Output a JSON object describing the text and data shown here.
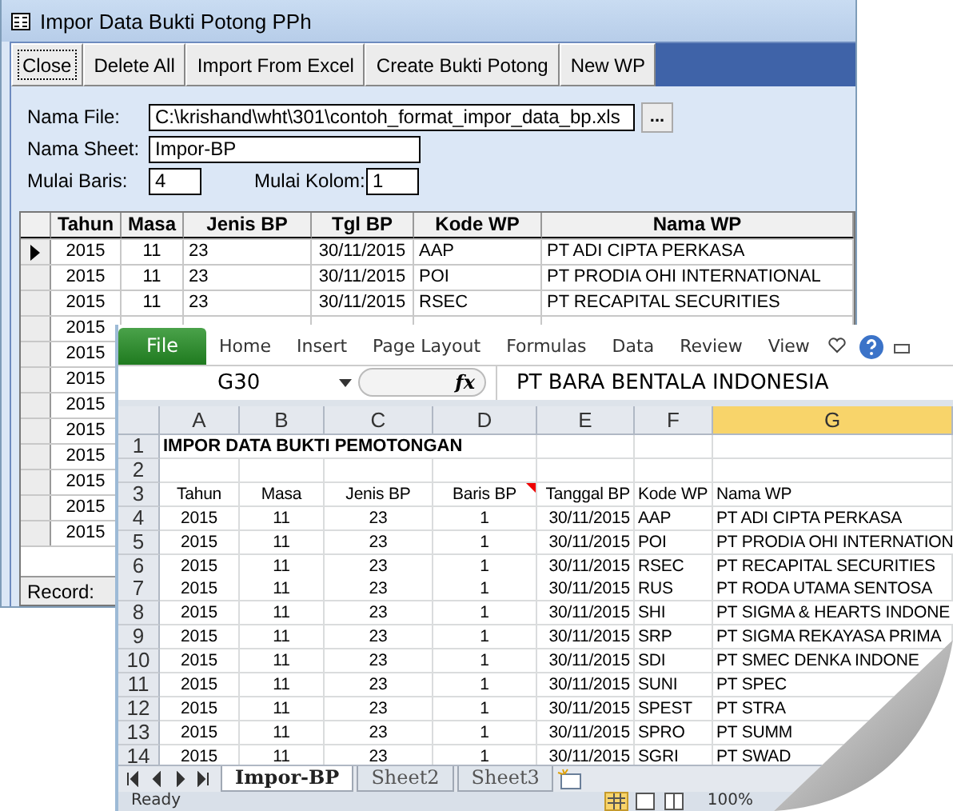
{
  "access_window": {
    "title": "Impor Data Bukti Potong PPh",
    "toolbar": [
      {
        "label": "Close",
        "focused": true
      },
      {
        "label": "Delete All",
        "focused": false
      },
      {
        "label": "Import From Excel",
        "focused": false
      },
      {
        "label": "Create Bukti Potong",
        "focused": false
      },
      {
        "label": "New WP",
        "focused": false
      }
    ],
    "file": {
      "label": "Nama File:",
      "value": "C:\\krishand\\wht\\301\\contoh_format_impor_data_bp.xls",
      "browse": "..."
    },
    "sheet": {
      "label": "Nama Sheet:",
      "value": "Impor-BP"
    },
    "start_row": {
      "label": "Mulai Baris:",
      "value": "4"
    },
    "start_col": {
      "label": "Mulai Kolom:",
      "value": "1"
    },
    "grid": {
      "columns": [
        "Tahun",
        "Masa",
        "Jenis BP",
        "Tgl BP",
        "Kode WP",
        "Nama WP"
      ],
      "rows": [
        {
          "selected": true,
          "cells": [
            "2015",
            "11",
            "23",
            "30/11/2015",
            "AAP",
            "PT ADI CIPTA PERKASA"
          ]
        },
        {
          "selected": false,
          "cells": [
            "2015",
            "11",
            "23",
            "30/11/2015",
            "POI",
            "PT PRODIA OHI INTERNATIONAL"
          ]
        },
        {
          "selected": false,
          "cells": [
            "2015",
            "11",
            "23",
            "30/11/2015",
            "RSEC",
            "PT RECAPITAL SECURITIES"
          ]
        },
        {
          "selected": false,
          "cells": [
            "2015"
          ]
        },
        {
          "selected": false,
          "cells": [
            "2015"
          ]
        },
        {
          "selected": false,
          "cells": [
            "2015"
          ]
        },
        {
          "selected": false,
          "cells": [
            "2015"
          ]
        },
        {
          "selected": false,
          "cells": [
            "2015"
          ]
        },
        {
          "selected": false,
          "cells": [
            "2015"
          ]
        },
        {
          "selected": false,
          "cells": [
            "2015"
          ]
        },
        {
          "selected": false,
          "cells": [
            "2015"
          ]
        },
        {
          "selected": false,
          "cells": [
            "2015"
          ]
        }
      ],
      "record_label": "Record:"
    }
  },
  "excel_window": {
    "ribbon_tabs": [
      {
        "label": "File",
        "kind": "file"
      },
      {
        "label": "Home",
        "kind": "tab"
      },
      {
        "label": "Insert",
        "kind": "tab"
      },
      {
        "label": "Page Layout",
        "kind": "tab"
      },
      {
        "label": "Formulas",
        "kind": "tab"
      },
      {
        "label": "Data",
        "kind": "tab"
      },
      {
        "label": "Review",
        "kind": "tab"
      },
      {
        "label": "View",
        "kind": "tab"
      }
    ],
    "name_box": "G30",
    "fx": "fx",
    "formula": "PT BARA BENTALA INDONESIA",
    "columns": [
      {
        "label": "A",
        "selected": false
      },
      {
        "label": "B",
        "selected": false
      },
      {
        "label": "C",
        "selected": false
      },
      {
        "label": "D",
        "selected": false
      },
      {
        "label": "E",
        "selected": false
      },
      {
        "label": "F",
        "selected": false
      },
      {
        "label": "G",
        "selected": true
      }
    ],
    "rows": [
      {
        "number": "1",
        "kind": "title",
        "cells": [
          "IMPOR DATA BUKTI PEMOTONGAN"
        ]
      },
      {
        "number": "2",
        "kind": "blank",
        "cells": []
      },
      {
        "number": "3",
        "kind": "header",
        "cells": [
          "Tahun",
          "Masa",
          "Jenis BP",
          "Baris BP",
          "Tanggal BP",
          "Kode WP",
          "Nama WP"
        ],
        "comment_flags": [
          false,
          false,
          false,
          true,
          false,
          false,
          false
        ]
      },
      {
        "number": "4",
        "kind": "data",
        "cells": [
          "2015",
          "11",
          "23",
          "1",
          "30/11/2015",
          "AAP",
          "PT ADI CIPTA PERKASA"
        ]
      },
      {
        "number": "5",
        "kind": "data",
        "cells": [
          "2015",
          "11",
          "23",
          "1",
          "30/11/2015",
          "POI",
          "PT PRODIA OHI INTERNATION"
        ]
      },
      {
        "number": "6",
        "kind": "data",
        "cells": [
          "2015",
          "11",
          "23",
          "1",
          "30/11/2015",
          "RSEC",
          "PT RECAPITAL SECURITIES"
        ]
      },
      {
        "number": "7",
        "kind": "data",
        "cells": [
          "2015",
          "11",
          "23",
          "1",
          "30/11/2015",
          "RUS",
          "PT RODA UTAMA SENTOSA"
        ]
      },
      {
        "number": "8",
        "kind": "data",
        "cells": [
          "2015",
          "11",
          "23",
          "1",
          "30/11/2015",
          "SHI",
          "PT SIGMA & HEARTS INDONE"
        ]
      },
      {
        "number": "9",
        "kind": "data",
        "cells": [
          "2015",
          "11",
          "23",
          "1",
          "30/11/2015",
          "SRP",
          "PT SIGMA REKAYASA PRIMA"
        ]
      },
      {
        "number": "10",
        "kind": "data",
        "cells": [
          "2015",
          "11",
          "23",
          "1",
          "30/11/2015",
          "SDI",
          "PT SMEC DENKA INDONE"
        ]
      },
      {
        "number": "11",
        "kind": "data",
        "cells": [
          "2015",
          "11",
          "23",
          "1",
          "30/11/2015",
          "SUNI",
          "PT SPEC"
        ]
      },
      {
        "number": "12",
        "kind": "data",
        "cells": [
          "2015",
          "11",
          "23",
          "1",
          "30/11/2015",
          "SPEST",
          "PT STRA"
        ]
      },
      {
        "number": "13",
        "kind": "data",
        "cells": [
          "2015",
          "11",
          "23",
          "1",
          "30/11/2015",
          "SPRO",
          "PT SUMM"
        ]
      },
      {
        "number": "14",
        "kind": "data",
        "cells": [
          "2015",
          "11",
          "23",
          "1",
          "30/11/2015",
          "SGRI",
          "PT SWAD"
        ]
      }
    ],
    "sheet_tabs": [
      {
        "label": "Impor-BP",
        "selected": true
      },
      {
        "label": "Sheet2",
        "selected": false
      },
      {
        "label": "Sheet3",
        "selected": false
      }
    ],
    "status": "Ready",
    "zoom": "100%"
  }
}
